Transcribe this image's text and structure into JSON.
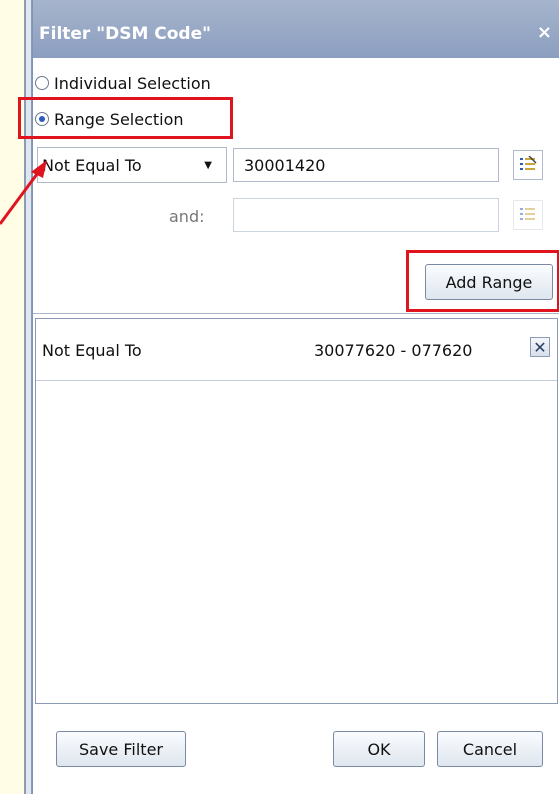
{
  "dialog": {
    "title": "Filter \"DSM Code\"",
    "close_glyph": "×"
  },
  "selection_mode": {
    "individual_label": "Individual Selection",
    "range_label": "Range Selection",
    "selected": "range"
  },
  "range": {
    "operator": "Not Equal To",
    "operator_arrow": "▼",
    "value": "30001420",
    "and_label": "and:",
    "second_value": ""
  },
  "buttons": {
    "add_range": "Add Range",
    "save_filter": "Save Filter",
    "ok": "OK",
    "cancel": "Cancel"
  },
  "ranges": [
    {
      "operator": "Not Equal To",
      "value": "30077620 - 077620",
      "remove_glyph": "✕"
    }
  ],
  "colors": {
    "title_bar": "#8c9ec0",
    "highlight": "#e0141e",
    "annotation_arrow": "#e0141e"
  },
  "icons": [
    "list-value-icon",
    "remove-icon",
    "close-icon"
  ]
}
